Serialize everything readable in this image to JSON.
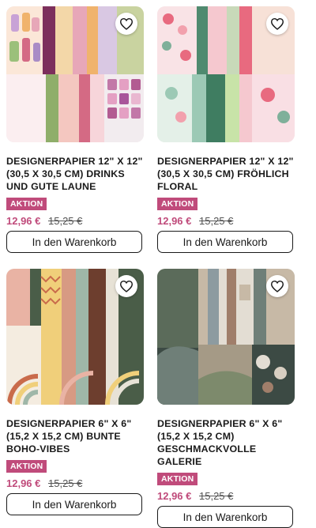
{
  "products": [
    {
      "title": "DESIGNERPAPIER 12\" X 12\" (30,5 X 30,5 CM) DRINKS UND GUTE LAUNE",
      "badge": "AKTION",
      "price_new": "12,96 €",
      "price_old": "15,25 €",
      "button": "In den Warenkorb",
      "favorite_icon": "heart-outline-icon",
      "image_palette": [
        "#e7a7b8",
        "#7c2f5c",
        "#f0b36c",
        "#c9d3a0",
        "#f3d7a8",
        "#d46a84",
        "#8fae6a",
        "#a98cc6"
      ]
    },
    {
      "title": "DESIGNERPAPIER 12\" X 12\" (30,5 X 30,5 CM) FRÖHLICH FLORAL",
      "badge": "AKTION",
      "price_new": "12,96 €",
      "price_old": "15,25 €",
      "button": "In den Warenkorb",
      "favorite_icon": "heart-outline-icon",
      "image_palette": [
        "#f5c8cf",
        "#7fb09a",
        "#e86a7f",
        "#c8d9b9",
        "#f2a1ad",
        "#4f8a6f",
        "#f7e1d7",
        "#9cc9b5"
      ]
    },
    {
      "title": "DESIGNERPAPIER 6\" X 6\" (15,2 X 15,2 CM) BUNTE BOHO-VIBES",
      "badge": "AKTION",
      "price_new": "12,96 €",
      "price_old": "15,25 €",
      "button": "In den Warenkorb",
      "favorite_icon": "heart-outline-icon",
      "image_palette": [
        "#e9b3a4",
        "#4a5d48",
        "#f0cf7a",
        "#c96b4b",
        "#9fb7a8",
        "#e7e2d6",
        "#6d3e2e",
        "#d79a83"
      ]
    },
    {
      "title": "DESIGNERPAPIER 6\" X 6\" (15,2 X 15,2 CM) GESCHMACKVOLLE GALERIE",
      "badge": "AKTION",
      "price_new": "12,96 €",
      "price_old": "15,25 €",
      "button": "In den Warenkorb",
      "favorite_icon": "heart-outline-icon",
      "image_palette": [
        "#5b6b5a",
        "#c7b9a6",
        "#8d9ba0",
        "#3c4a44",
        "#e3ddd3",
        "#a07e6a",
        "#6f7f78",
        "#d8cfc2"
      ]
    }
  ],
  "colors": {
    "accent": "#c04b7b",
    "text": "#1a1a1a"
  }
}
